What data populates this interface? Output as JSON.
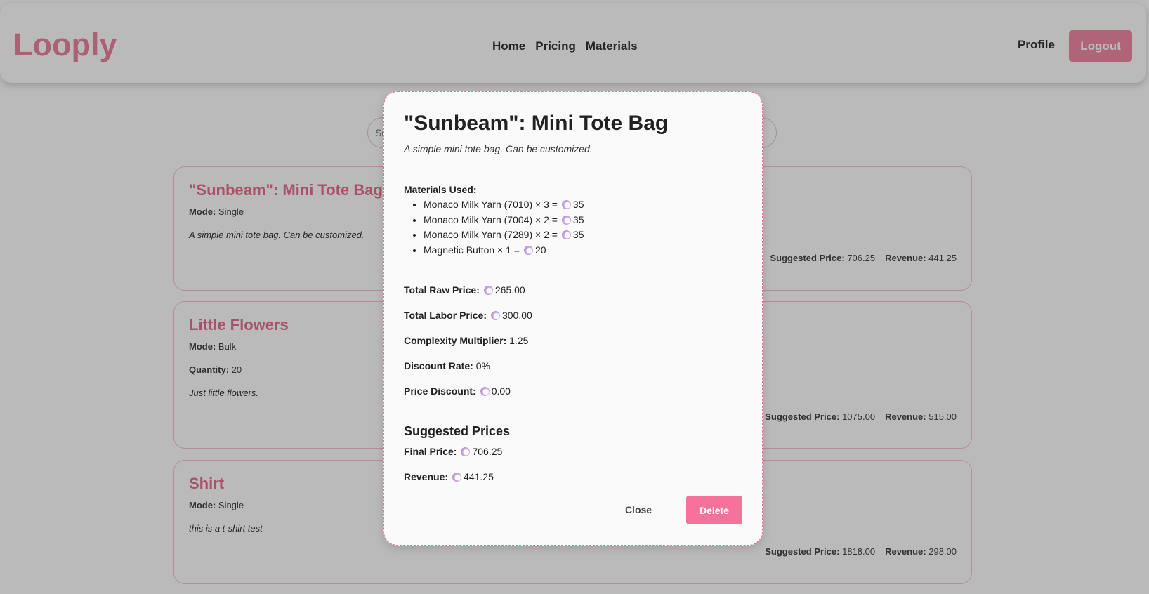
{
  "header": {
    "logo": "Looply",
    "nav": [
      "Home",
      "Pricing",
      "Materials"
    ],
    "profile_label": "Profile",
    "logout_label": "Logout"
  },
  "search": {
    "placeholder": "Se"
  },
  "labels": {
    "mode": "Mode:",
    "quantity": "Quantity:",
    "suggested_price": "Suggested Price:",
    "revenue": "Revenue:"
  },
  "cards": [
    {
      "title": "\"Sunbeam\": Mini Tote Bag",
      "mode": "Single",
      "description": "A simple mini tote bag. Can be customized.",
      "suggested_price": "706.25",
      "revenue": "441.25"
    },
    {
      "title": "Little Flowers",
      "mode": "Bulk",
      "quantity": "20",
      "description": "Just little flowers.",
      "suggested_price": "1075.00",
      "revenue": "515.00"
    },
    {
      "title": "Shirt",
      "mode": "Single",
      "description": "this is a t-shirt test",
      "suggested_price": "1818.00",
      "revenue": "298.00"
    }
  ],
  "modal": {
    "title": "\"Sunbeam\": Mini Tote Bag",
    "description": "A simple mini tote bag. Can be customized.",
    "materials_label": "Materials Used:",
    "materials": [
      {
        "text": "Monaco Milk Yarn (7010) × 3 =",
        "price": "35"
      },
      {
        "text": "Monaco Milk Yarn (7004) × 2 =",
        "price": "35"
      },
      {
        "text": "Monaco Milk Yarn (7289) × 2 =",
        "price": "35"
      },
      {
        "text": "Magnetic Button × 1 =",
        "price": "20"
      }
    ],
    "total_raw_label": "Total Raw Price:",
    "total_raw_value": "265.00",
    "total_labor_label": "Total Labor Price:",
    "total_labor_value": "300.00",
    "complexity_label": "Complexity Multiplier:",
    "complexity_value": "1.25",
    "discount_rate_label": "Discount Rate:",
    "discount_rate_value": "0%",
    "price_discount_label": "Price Discount:",
    "price_discount_value": "0.00",
    "suggested_heading": "Suggested Prices",
    "final_price_label": "Final Price:",
    "final_price_value": "706.25",
    "revenue_label": "Revenue:",
    "revenue_value": "441.25",
    "close_label": "Close",
    "delete_label": "Delete"
  },
  "icons": {
    "currency": "coin-icon"
  },
  "colors": {
    "brand": "#e8859e",
    "title_pink": "#e8708f",
    "delete_button": "#f5739a",
    "logout_button": "#f28aa5"
  }
}
